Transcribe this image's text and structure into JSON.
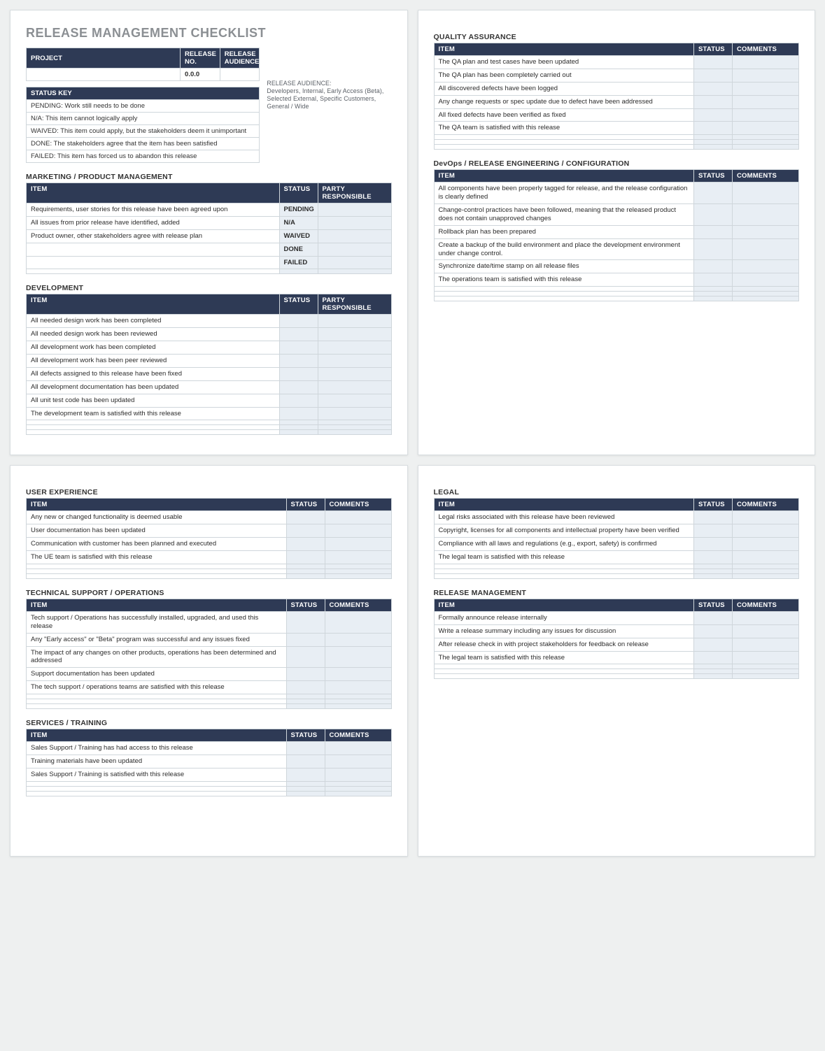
{
  "doc_title": "RELEASE MANAGEMENT CHECKLIST",
  "project_header": {
    "col_project": "PROJECT",
    "col_release_no": "RELEASE NO.",
    "col_release_audience": "RELEASE AUDIENCE",
    "project": "",
    "release_no": "0.0.0",
    "release_audience": ""
  },
  "release_audience_note": "RELEASE AUDIENCE:\nDevelopers, Internal, Early Access (Beta), Selected External, Specific Customers, General / Wide",
  "status_key": {
    "title": "STATUS KEY",
    "rows": [
      "PENDING:  Work still needs to be done",
      "N/A:  This item cannot logically apply",
      "WAIVED:  This item could apply, but the stakeholders deem it unimportant",
      "DONE:  The stakeholders agree that the item has been satisfied",
      "FAILED:  This item has forced us to abandon this release"
    ]
  },
  "col": {
    "item": "ITEM",
    "status": "STATUS",
    "party": "PARTY RESPONSIBLE",
    "comments": "COMMENTS"
  },
  "sections": {
    "marketing": {
      "title": "MARKETING / PRODUCT MANAGEMENT",
      "cols": [
        "item",
        "status",
        "party"
      ],
      "rows": [
        {
          "item": "Requirements, user stories for this release have been agreed upon",
          "status": "PENDING"
        },
        {
          "item": "All issues from prior release have identified, added",
          "status": "N/A"
        },
        {
          "item": "Product owner, other stakeholders agree with release plan",
          "status": "WAIVED"
        },
        {
          "item": "",
          "status": "DONE"
        },
        {
          "item": "",
          "status": "FAILED"
        },
        {
          "item": "",
          "status": ""
        }
      ]
    },
    "development": {
      "title": "DEVELOPMENT",
      "cols": [
        "item",
        "status",
        "party"
      ],
      "rows": [
        {
          "item": "All needed design work has been completed"
        },
        {
          "item": "All needed design work has been reviewed"
        },
        {
          "item": "All development work has been completed"
        },
        {
          "item": "All development work has been peer reviewed"
        },
        {
          "item": "All defects assigned to this release have been fixed"
        },
        {
          "item": "All development documentation has been updated"
        },
        {
          "item": "All unit test code has been updated"
        },
        {
          "item": "The development team is satisfied with this release"
        },
        {
          "item": ""
        },
        {
          "item": ""
        },
        {
          "item": ""
        }
      ]
    },
    "qa": {
      "title": "QUALITY ASSURANCE",
      "cols": [
        "item",
        "status",
        "comments"
      ],
      "rows": [
        {
          "item": "The QA plan and test cases have been updated"
        },
        {
          "item": "The QA plan has been completely carried out"
        },
        {
          "item": "All discovered defects have been logged"
        },
        {
          "item": "Any change requests or spec update due to defect have been addressed"
        },
        {
          "item": "All fixed defects have been verified as fixed"
        },
        {
          "item": "The QA team is satisfied with this release"
        },
        {
          "item": ""
        },
        {
          "item": ""
        },
        {
          "item": ""
        }
      ]
    },
    "devops": {
      "title": "DevOps / RELEASE ENGINEERING / CONFIGURATION",
      "cols": [
        "item",
        "status",
        "comments"
      ],
      "rows": [
        {
          "item": "All components have been properly tagged for release, and the release configuration is clearly defined"
        },
        {
          "item": "Change-control practices have been followed, meaning that the released product does not contain unapproved changes"
        },
        {
          "item": "Rollback plan has been prepared"
        },
        {
          "item": "Create a backup of the build environment and place the development environment under change control."
        },
        {
          "item": "Synchronize date/time stamp on all release files"
        },
        {
          "item": "The operations team is satisfied with this release"
        },
        {
          "item": ""
        },
        {
          "item": ""
        },
        {
          "item": ""
        }
      ]
    },
    "ux": {
      "title": "USER EXPERIENCE",
      "cols": [
        "item",
        "status",
        "comments"
      ],
      "rows": [
        {
          "item": "Any new or changed functionality is deemed usable"
        },
        {
          "item": "User documentation has been updated"
        },
        {
          "item": "Communication with customer has been planned and executed"
        },
        {
          "item": "The UE team is satisfied with this release"
        },
        {
          "item": ""
        },
        {
          "item": ""
        },
        {
          "item": ""
        }
      ]
    },
    "support": {
      "title": "TECHNICAL SUPPORT / OPERATIONS",
      "cols": [
        "item",
        "status",
        "comments"
      ],
      "rows": [
        {
          "item": "Tech support / Operations has successfully installed, upgraded, and used this release"
        },
        {
          "item": "Any \"Early access\" or \"Beta\" program was successful and any issues fixed"
        },
        {
          "item": "The impact of any changes on other products, operations has been determined and addressed"
        },
        {
          "item": "Support documentation has been updated"
        },
        {
          "item": "The tech support / operations teams are satisfied with this release"
        },
        {
          "item": ""
        },
        {
          "item": ""
        },
        {
          "item": ""
        }
      ]
    },
    "training": {
      "title": "SERVICES / TRAINING",
      "cols": [
        "item",
        "status",
        "comments"
      ],
      "rows": [
        {
          "item": "Sales Support / Training has had access to this release"
        },
        {
          "item": "Training materials have been updated"
        },
        {
          "item": "Sales Support / Training is satisfied with this release"
        },
        {
          "item": ""
        },
        {
          "item": ""
        },
        {
          "item": ""
        }
      ]
    },
    "legal": {
      "title": "LEGAL",
      "cols": [
        "item",
        "status",
        "comments"
      ],
      "rows": [
        {
          "item": "Legal risks associated with this release have been reviewed"
        },
        {
          "item": "Copyright, licenses for all components and intellectual property have been verified"
        },
        {
          "item": "Compliance with all laws and regulations (e.g., export, safety) is confirmed"
        },
        {
          "item": "The legal team is satisfied with this release"
        },
        {
          "item": ""
        },
        {
          "item": ""
        },
        {
          "item": ""
        }
      ]
    },
    "relmgmt": {
      "title": "RELEASE MANAGEMENT",
      "cols": [
        "item",
        "status",
        "comments"
      ],
      "rows": [
        {
          "item": "Formally announce release internally"
        },
        {
          "item": "Write a release summary including any issues for discussion"
        },
        {
          "item": "After release check in with project stakeholders for feedback on release"
        },
        {
          "item": "The legal team is satisfied with this release"
        },
        {
          "item": ""
        },
        {
          "item": ""
        },
        {
          "item": ""
        }
      ]
    }
  }
}
